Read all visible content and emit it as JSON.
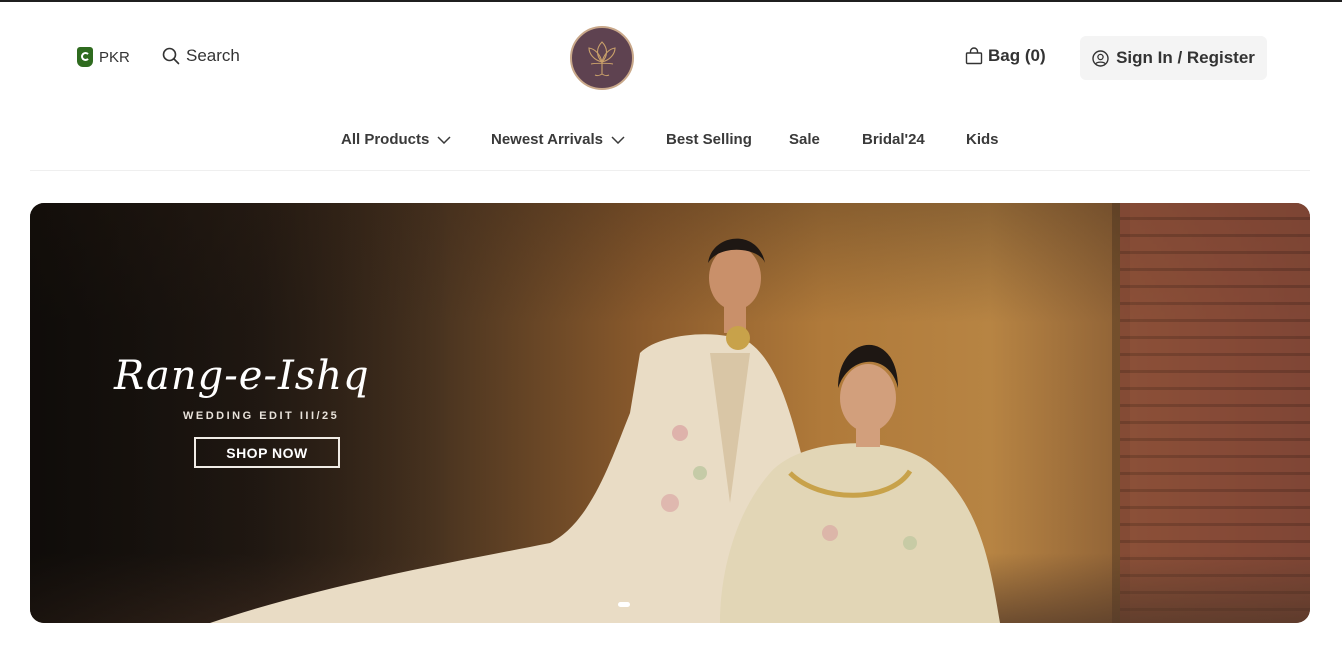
{
  "header": {
    "currency": "PKR",
    "search_label": "Search",
    "bag_label": "Bag (0)",
    "signin_label": "Sign In / Register"
  },
  "nav": {
    "items": [
      {
        "label": "All Products",
        "has_dropdown": true
      },
      {
        "label": "Newest Arrivals",
        "has_dropdown": true
      },
      {
        "label": "Best Selling",
        "has_dropdown": false
      },
      {
        "label": "Sale",
        "has_dropdown": false
      },
      {
        "label": "Bridal'24",
        "has_dropdown": false
      },
      {
        "label": "Kids",
        "has_dropdown": false
      }
    ]
  },
  "banner": {
    "script_title": "Rang-e-Ishq",
    "subtitle": "WEDDING EDIT III/25",
    "cta_label": "SHOP NOW",
    "slide_count": 1,
    "active_slide": 1
  },
  "colors": {
    "logo_bg": "#5e4250",
    "logo_ring": "#c9a88a",
    "flag_green": "#2f6b1f",
    "signin_bg": "#f4f4f4"
  }
}
